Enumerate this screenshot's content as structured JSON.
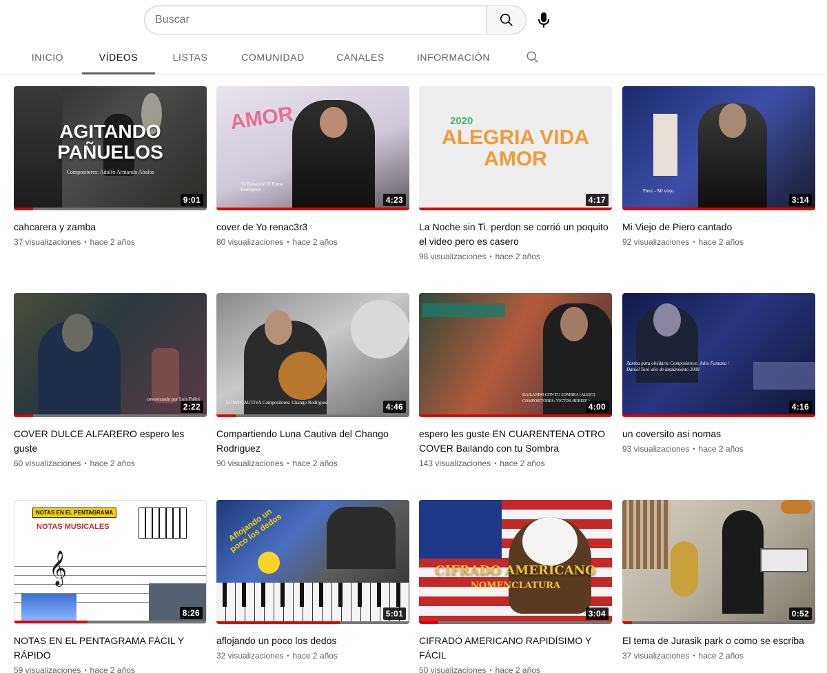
{
  "search": {
    "placeholder": "Buscar"
  },
  "tabs": [
    {
      "label": "INICIO"
    },
    {
      "label": "VÍDEOS"
    },
    {
      "label": "LISTAS"
    },
    {
      "label": "COMUNIDAD"
    },
    {
      "label": "CANALES"
    },
    {
      "label": "INFORMACIÓN"
    }
  ],
  "active_tab": "VÍDEOS",
  "videos": [
    {
      "title": "cahcarera y zamba",
      "views": "37 visualizaciones",
      "age": "hace 2 años",
      "duration": "9:01",
      "thumb_text": "AGITANDO PAÑUELOS",
      "thumb_sub": "Compositores: Adolfo Armando Abalos"
    },
    {
      "title": "cover de Yo renac3r3",
      "views": "80 visualizaciones",
      "age": "hace 2 años",
      "duration": "4:23",
      "thumb_text": "VIDA AMOR",
      "thumb_sub": "Yo Renaceré El Puma Rodríguez"
    },
    {
      "title": "La Noche sin Ti. perdon se corrió un poquito el video pero es casero",
      "views": "98 visualizaciones",
      "age": "hace 2 años",
      "duration": "4:17",
      "thumb_text": "ALEGRIA VIDA AMOR",
      "thumb_sub": "2020"
    },
    {
      "title": "Mi Viejo de Piero cantado",
      "views": "92 visualizaciones",
      "age": "hace 2 años",
      "duration": "3:14",
      "thumb_text": "",
      "thumb_sub": "Piero - Mi viejo"
    },
    {
      "title": "COVER DULCE ALFARERO espero les guste",
      "views": "60 visualizaciones",
      "age": "hace 2 años",
      "duration": "2:22",
      "thumb_text": "",
      "thumb_sub": "coverezrado por Luis Pañui"
    },
    {
      "title": "Compartiendo Luna Cautiva del Chango Rodriguez",
      "views": "90 visualizaciones",
      "age": "hace 2 años",
      "duration": "4:46",
      "thumb_text": "",
      "thumb_sub": "LUNA CAUTIVA Compositores: Chango Rodriguez"
    },
    {
      "title": "espero les guste EN CUARENTENA OTRO COVER Bailando con tu Sombra",
      "views": "143 visualizaciones",
      "age": "hace 2 años",
      "duration": "4:00",
      "thumb_text": "",
      "thumb_sub": "BAILANDO CON TU SOMBRA (ALEJO) COMPOSITORES: VICTOR HEREDIA"
    },
    {
      "title": "un coversito asi nomas",
      "views": "93 visualizaciones",
      "age": "hace 2 años",
      "duration": "4:16",
      "thumb_text": "",
      "thumb_sub": "Zamba para olvidarte Compositores: Julio Fontana / Daniel Toro año de lanzamiento 2009"
    },
    {
      "title": "NOTAS EN EL PENTAGRAMA FÁCIL Y RÁPIDO",
      "views": "59 visualizaciones",
      "age": "hace 2 años",
      "duration": "8:26",
      "thumb_text": "NOTAS MUSICALES",
      "thumb_sub": "NOTAS EN EL PENTAGRAMA"
    },
    {
      "title": "aflojando un poco los dedos",
      "views": "32 visualizaciones",
      "age": "hace 2 años",
      "duration": "5:01",
      "thumb_text": "Aflojando un poco los dedos",
      "thumb_sub": ""
    },
    {
      "title": "CIFRADO AMERICANO RAPIDÍSIMO Y FÁCIL",
      "views": "50 visualizaciones",
      "age": "hace 2 años",
      "duration": "3:04",
      "thumb_text": "CIFRADO AMERICANO",
      "thumb_sub": "NOMENCLATURA"
    },
    {
      "title": "El tema de Jurasik park o como se escriba",
      "views": "37 visualizaciones",
      "age": "hace 2 años",
      "duration": "0:52",
      "thumb_text": "",
      "thumb_sub": ""
    }
  ],
  "colors": {
    "progress_red": "#e20000",
    "text_secondary": "#606060"
  }
}
